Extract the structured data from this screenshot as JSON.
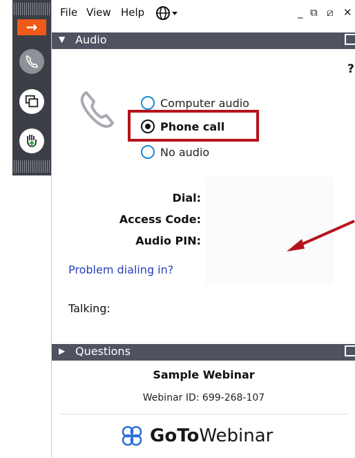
{
  "menu": {
    "file": "File",
    "view": "View",
    "help": "Help"
  },
  "window_controls": {
    "minimize": "_",
    "restore": "⧉",
    "expand": "⧄",
    "close": "✕"
  },
  "audio": {
    "section_title": "Audio",
    "help_icon": "?",
    "options": [
      {
        "label": "Computer audio",
        "selected": false
      },
      {
        "label": "Phone call",
        "selected": true
      },
      {
        "label": "No audio",
        "selected": false
      }
    ],
    "fields": {
      "dial": "Dial:",
      "access_code": "Access Code:",
      "audio_pin": "Audio PIN:"
    },
    "problem_link": "Problem dialing in?",
    "talking": "Talking:"
  },
  "questions": {
    "section_title": "Questions"
  },
  "webinar": {
    "title": "Sample Webinar",
    "id_text": "Webinar ID: 699-268-107"
  },
  "logo": {
    "goto": "GoTo",
    "webinar": "Webinar"
  },
  "colors": {
    "accent_orange": "#f05a1a",
    "highlight_red": "#b5121b",
    "radio_blue": "#1b8ad6",
    "section_bar": "#4f5360"
  },
  "icons": [
    "arrow-right-icon",
    "phone-icon",
    "screen-share-icon",
    "raise-hand-icon",
    "globe-icon",
    "phone-handset-icon",
    "gotowebinar-logo-icon"
  ]
}
